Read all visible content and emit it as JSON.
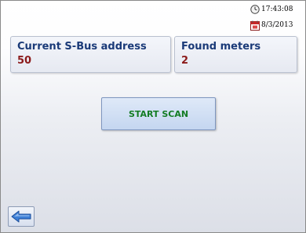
{
  "status": {
    "time": "17:43:08",
    "date": "8/3/2013",
    "clock_icon": "clock-icon",
    "calendar_icon": "calendar-icon"
  },
  "address_card": {
    "title": "Current S-Bus address",
    "value": "50"
  },
  "meters_card": {
    "title": "Found meters",
    "value": "2"
  },
  "scan_button": {
    "label": "START SCAN"
  },
  "back_button": {
    "icon": "back-arrow-icon"
  },
  "colors": {
    "card_title": "#1a3a78",
    "card_value": "#8b1a1a",
    "scan_label": "#137c24",
    "back_arrow": "#3d7fd6"
  }
}
